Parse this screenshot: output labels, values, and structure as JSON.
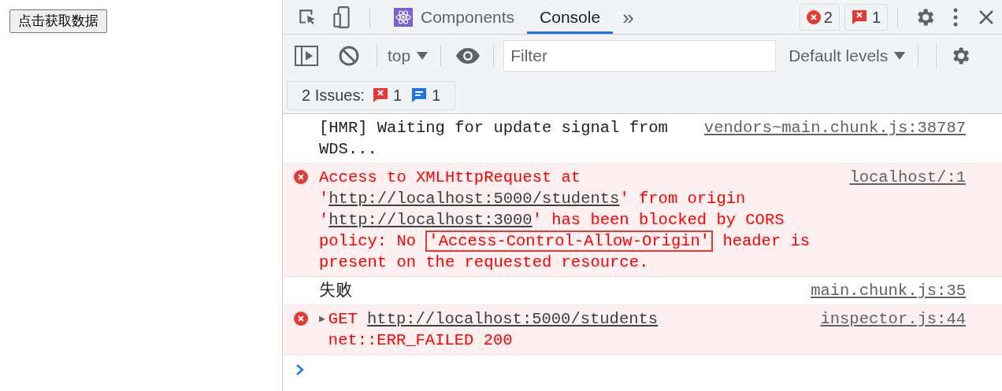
{
  "page": {
    "button": "点击获取数据"
  },
  "devtools": {
    "tabs": [
      {
        "label": "Components",
        "selected": false
      },
      {
        "label": "Console",
        "selected": true
      }
    ],
    "more_tabs": "»",
    "error_count": "2",
    "issue_count": "1",
    "context": "top",
    "filter": {
      "placeholder": "Filter"
    },
    "levels": "Default levels",
    "issues": {
      "label": "2 Issues:",
      "errors": "1",
      "infos": "1"
    },
    "messages": [
      {
        "kind": "log",
        "source": "vendors~main.chunk.js:38787",
        "segments": [
          {
            "kind": "text",
            "text": "[HMR] Waiting for update signal from WDS..."
          }
        ]
      },
      {
        "kind": "error",
        "source": "localhost/:1",
        "segments": [
          {
            "kind": "text",
            "text": "Access to XMLHttpRequest at '"
          },
          {
            "kind": "link",
            "text": "http://localhost:5000/students"
          },
          {
            "kind": "text",
            "text": "' from origin '"
          },
          {
            "kind": "link",
            "text": "http://localhost:3000"
          },
          {
            "kind": "text",
            "text": "' has been blocked by CORS policy: No "
          },
          {
            "kind": "highlight",
            "text": "'Access-Control-Allow-Origin'"
          },
          {
            "kind": "text",
            "text": " header is present on the requested resource."
          }
        ]
      },
      {
        "kind": "log",
        "source": "main.chunk.js:35",
        "segments": [
          {
            "kind": "text",
            "text": "失败"
          }
        ]
      },
      {
        "kind": "error",
        "expander": "▶",
        "source": "inspector.js:44",
        "segments": [
          {
            "kind": "text",
            "text": "GET "
          },
          {
            "kind": "link",
            "text": "http://localhost:5000/students"
          },
          {
            "kind": "text",
            "text": " net::ERR_FAILED 200"
          }
        ]
      }
    ]
  }
}
